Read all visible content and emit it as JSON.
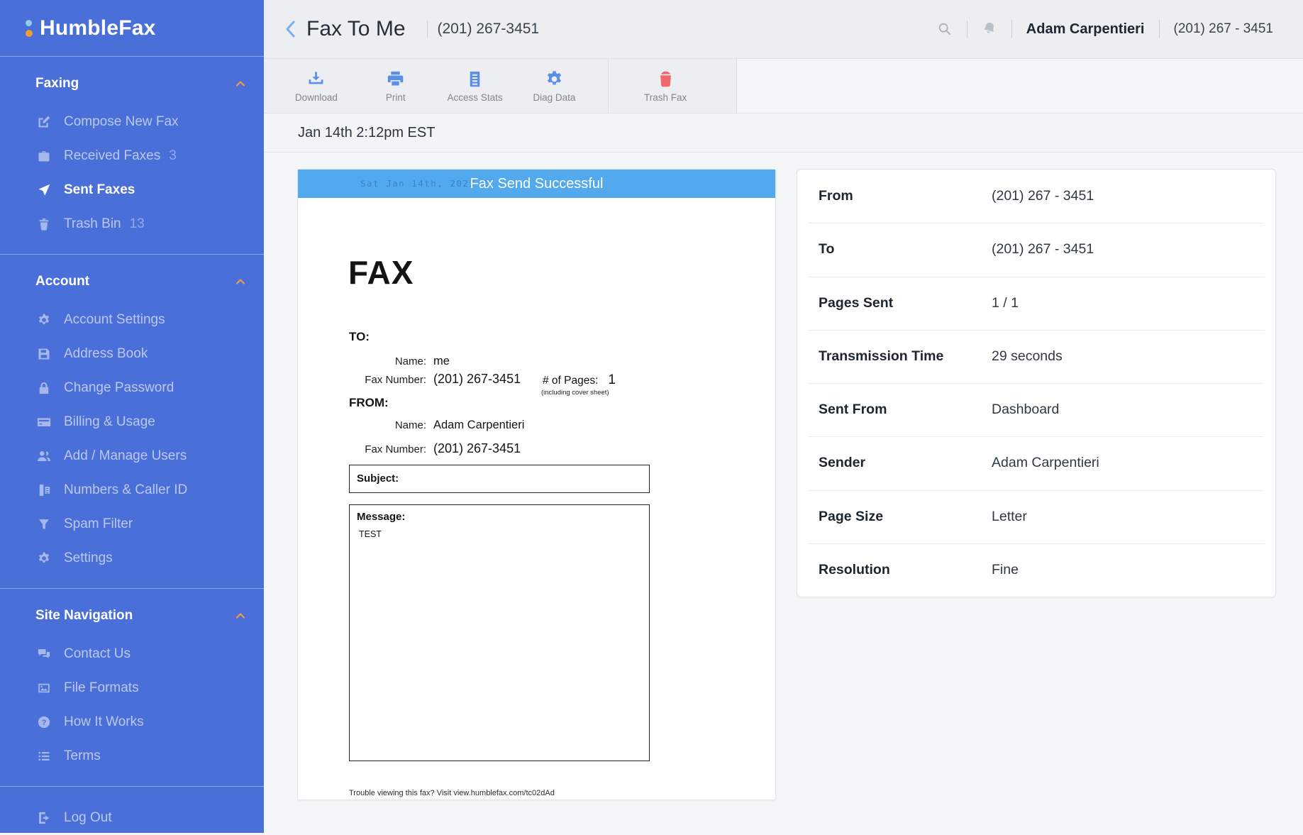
{
  "app": {
    "logo_text": "HumbleFax"
  },
  "colors": {
    "sidebar_bg": "#4a6fd8",
    "accent_orange": "#f09a4e",
    "logo_dot_blue": "#8ecdf0",
    "logo_dot_orange": "#f39b2d",
    "banner_blue": "#53a9ee",
    "toolbar_icon_blue": "#5c8fe9",
    "trash_red": "#f1696e",
    "header_bg": "#edeef1",
    "content_bg": "#f5f6f8"
  },
  "sidebar": {
    "sections": [
      {
        "label": "Faxing",
        "items": [
          {
            "icon": "compose-icon",
            "label": "Compose New Fax"
          },
          {
            "icon": "inbox-icon",
            "label": "Received Faxes",
            "count": "3"
          },
          {
            "icon": "paper-plane-icon",
            "label": "Sent Faxes",
            "active": true
          },
          {
            "icon": "trash-icon",
            "label": "Trash Bin",
            "count": "13"
          }
        ]
      },
      {
        "label": "Account",
        "items": [
          {
            "icon": "gear-icon",
            "label": "Account Settings"
          },
          {
            "icon": "floppy-icon",
            "label": "Address Book"
          },
          {
            "icon": "lock-icon",
            "label": "Change Password"
          },
          {
            "icon": "credit-card-icon",
            "label": "Billing & Usage"
          },
          {
            "icon": "users-icon",
            "label": "Add / Manage Users"
          },
          {
            "icon": "phone-icon",
            "label": "Numbers & Caller ID"
          },
          {
            "icon": "funnel-icon",
            "label": "Spam Filter"
          },
          {
            "icon": "gear-icon",
            "label": "Settings"
          }
        ]
      },
      {
        "label": "Site Navigation",
        "items": [
          {
            "icon": "chat-icon",
            "label": "Contact Us"
          },
          {
            "icon": "image-icon",
            "label": "File Formats"
          },
          {
            "icon": "question-icon",
            "label": "How It Works"
          },
          {
            "icon": "list-icon",
            "label": "Terms"
          }
        ]
      }
    ],
    "footer": {
      "icon": "logout-icon",
      "label": "Log Out"
    }
  },
  "header": {
    "title": "Fax To Me",
    "title_phone": "(201) 267-3451",
    "user_name": "Adam Carpentieri",
    "user_phone": "(201) 267 - 3451"
  },
  "toolbar": {
    "buttons": [
      {
        "icon": "download-icon",
        "label": "Download"
      },
      {
        "icon": "printer-icon",
        "label": "Print"
      },
      {
        "icon": "document-stats-icon",
        "label": "Access Stats"
      },
      {
        "icon": "gear-icon",
        "label": "Diag Data"
      }
    ],
    "trash": {
      "icon": "trash-icon",
      "label": "Trash Fax"
    }
  },
  "meta": {
    "date": "Jan 14th 2:12pm EST"
  },
  "fax_preview": {
    "banner_title": "Fax Send Successful",
    "banner_ghost_text": "Sat Jan 14th, 2023 2:",
    "title": "FAX",
    "to_heading": "TO:",
    "to_name_label": "Name:",
    "to_name": "me",
    "to_fax_label": "Fax Number:",
    "to_fax": "(201) 267-3451",
    "pages_label": "# of Pages:",
    "pages_value": "1",
    "pages_note": "(including cover sheet)",
    "from_heading": "FROM:",
    "from_name_label": "Name:",
    "from_name": "Adam Carpentieri",
    "from_fax_label": "Fax Number:",
    "from_fax": "(201) 267-3451",
    "subject_label": "Subject:",
    "message_label": "Message:",
    "message_text": "TEST",
    "footer_note": "Trouble viewing this fax? Visit view.humblefax.com/tc02dAd"
  },
  "details": {
    "rows": [
      {
        "label": "From",
        "value": "(201) 267 - 3451"
      },
      {
        "label": "To",
        "value": "(201) 267 - 3451"
      },
      {
        "label": "Pages Sent",
        "value": "1 / 1"
      },
      {
        "label": "Transmission Time",
        "value": "29 seconds"
      },
      {
        "label": "Sent From",
        "value": "Dashboard"
      },
      {
        "label": "Sender",
        "value": "Adam Carpentieri"
      },
      {
        "label": "Page Size",
        "value": "Letter"
      },
      {
        "label": "Resolution",
        "value": "Fine"
      }
    ]
  }
}
